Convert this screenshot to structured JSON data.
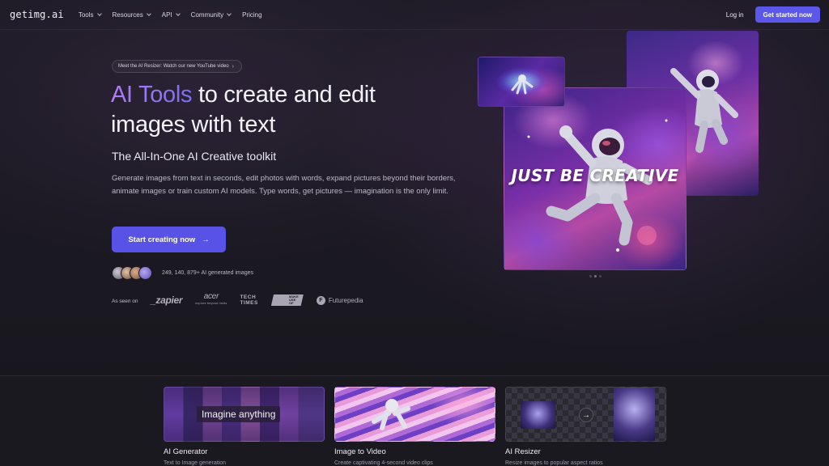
{
  "nav": {
    "logo": "getimg.ai",
    "links": [
      {
        "label": "Tools",
        "dropdown": true
      },
      {
        "label": "Resources",
        "dropdown": true
      },
      {
        "label": "API",
        "dropdown": true
      },
      {
        "label": "Community",
        "dropdown": true
      },
      {
        "label": "Pricing",
        "dropdown": false
      }
    ],
    "login": "Log in",
    "cta": "Get started now"
  },
  "hero": {
    "announcement": "Meet the AI Resizer: Watch our new YouTube video",
    "announcement_arrow": "›",
    "title_highlight": "AI Tools",
    "title_rest": " to create and edit images with text",
    "subtitle": "The All-In-One AI Creative toolkit",
    "description": "Generate images from text in seconds, edit photos with words, expand pictures beyond their borders, animate images or train custom AI models. Type words, get pictures — imagination is the only limit.",
    "cta": "Start creating now",
    "cta_arrow": "→",
    "stat": "249, 140, 879+ AI generated images",
    "seen_on": "As seen on",
    "press": {
      "zapier": "_zapier",
      "acer": "acer",
      "acer_tag": "explore beyond limits",
      "techtimes_1": "TECH",
      "techtimes_2": "TIMES",
      "muo_1": "MAKE",
      "muo_2": "USE",
      "muo_3": "OF",
      "futurepedia": "Futurepedia",
      "futurepedia_mark": "F"
    },
    "image_caption": "JUST BE CREATIVE",
    "carousel_active": 1,
    "carousel_count": 3
  },
  "features": [
    {
      "title": "AI Generator",
      "subtitle": "Text to Image generation",
      "overlay": "Imagine anything"
    },
    {
      "title": "Image to Video",
      "subtitle": "Create captivating 4-second video clips"
    },
    {
      "title": "AI Resizer",
      "subtitle": "Resize images to popular aspect ratios",
      "arrow": "→"
    }
  ],
  "colors": {
    "accent": "#5b57e8",
    "background": "#17151c",
    "gradient_start": "#b47cf4",
    "gradient_end": "#7b6ff2"
  },
  "icons": {
    "chevron": "chevron-down-icon",
    "arrow_right": "arrow-right-icon"
  }
}
